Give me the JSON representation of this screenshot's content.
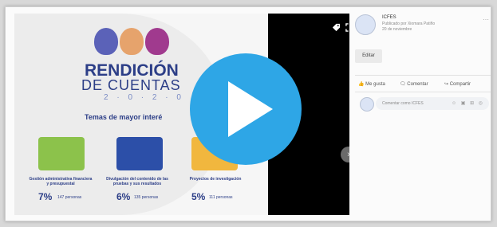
{
  "post": {
    "page_name": "ICFES",
    "published_by": "Publicado por Xiomara Patiño",
    "date": "20 de noviembre",
    "more_label": "···",
    "edit_label": "Editar",
    "actions": {
      "like": "Me gusta",
      "comment": "Comentar",
      "share": "Compartir"
    },
    "comment_placeholder": "Comentar como ICFES",
    "comment_icons": "☺ ▣ ⊞ ◎"
  },
  "slide": {
    "title_main": "RENDICIÓN",
    "title_sub": "DE CUENTAS",
    "year": "2 · 0 · 2 · 0",
    "topic_head": "Temas de mayor interé",
    "cards": [
      {
        "caption": "Gestión administrativa financiera y presupuestal",
        "pct": "7%",
        "persons": "147 personas"
      },
      {
        "caption": "Divulgación del contenido de las pruebas y sus resultados",
        "pct": "6%",
        "persons": "135 personas"
      },
      {
        "caption": "Proyectos de investigación",
        "pct": "5%",
        "persons": "111 personas"
      }
    ]
  },
  "colors": {
    "accent": "#2ea6e6",
    "brand": "#2c3e87"
  },
  "icons": {
    "play": "play-icon",
    "tag": "tag-icon",
    "expand": "expand-icon",
    "next": "chevron-right-icon"
  }
}
